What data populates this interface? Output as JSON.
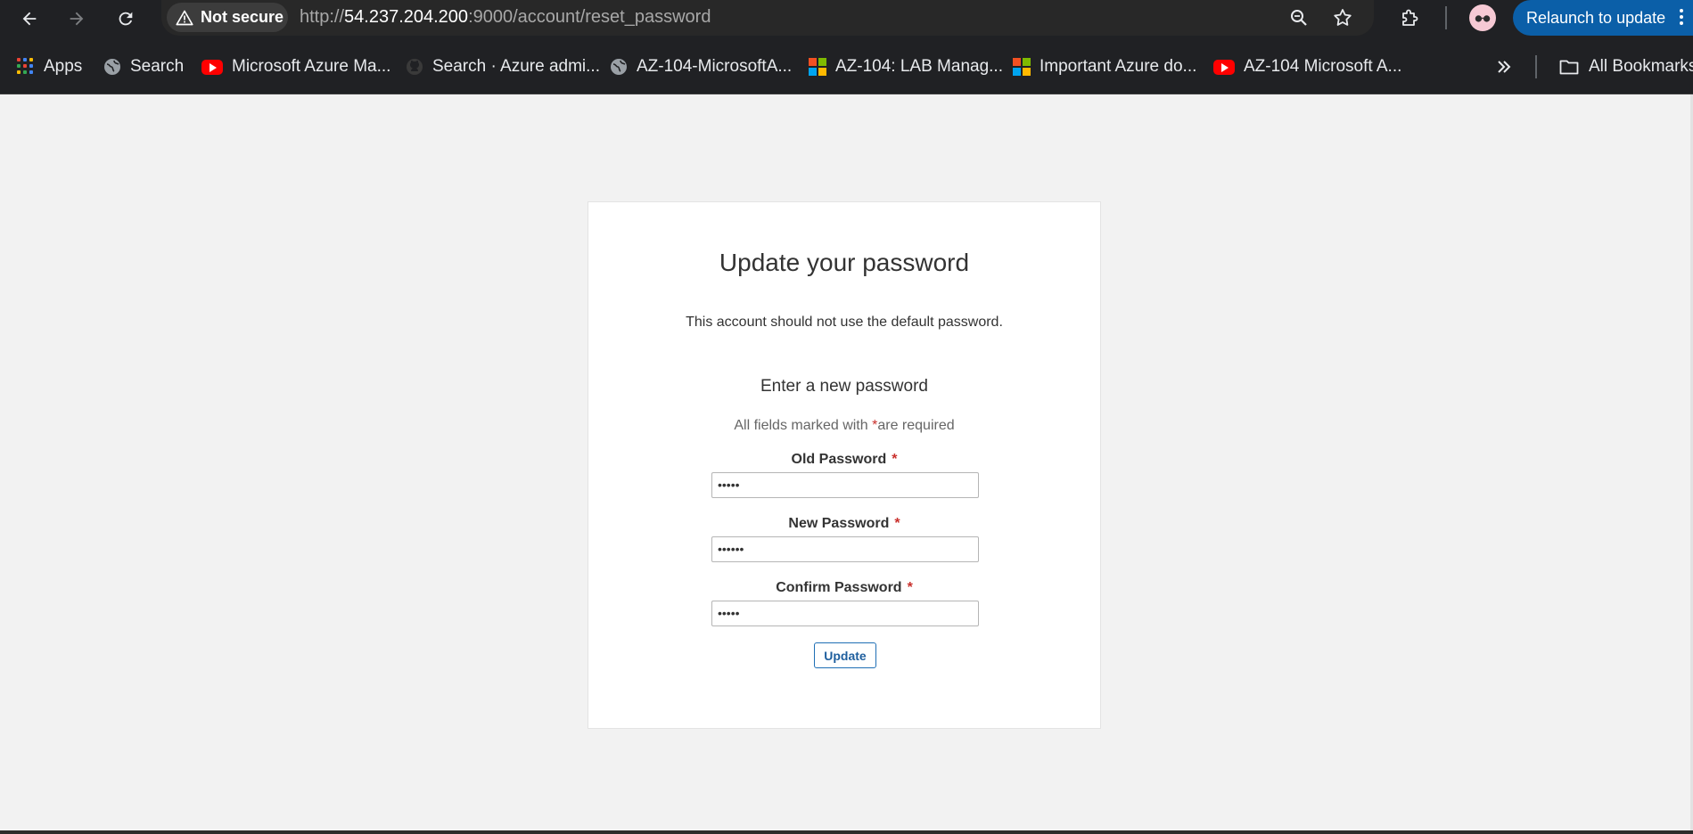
{
  "browser": {
    "security_label": "Not secure",
    "url_prefix": "http://",
    "url_host": "54.237.204.200",
    "url_rest": ":9000/account/reset_password",
    "relaunch_label": "Relaunch to update",
    "bookmarks": [
      {
        "label": "Apps",
        "icon": "apps-grid-icon"
      },
      {
        "label": "Search",
        "icon": "globe-icon"
      },
      {
        "label": "Microsoft Azure Ma...",
        "icon": "youtube-icon"
      },
      {
        "label": "Search · Azure admi...",
        "icon": "github-icon"
      },
      {
        "label": "AZ-104-MicrosoftA...",
        "icon": "globe-icon"
      },
      {
        "label": "AZ-104: LAB Manag...",
        "icon": "microsoft-icon"
      },
      {
        "label": "Important Azure do...",
        "icon": "microsoft-icon"
      },
      {
        "label": "AZ-104 Microsoft A...",
        "icon": "youtube-icon"
      }
    ],
    "all_bookmarks_label": "All Bookmarks"
  },
  "form": {
    "title": "Update your password",
    "notice": "This account should not use the default password.",
    "subtitle": "Enter a new password",
    "required_prefix": "All fields marked with",
    "required_star": "*",
    "required_suffix": "are required",
    "fields": [
      {
        "label": "Old Password",
        "value": "•••••"
      },
      {
        "label": "New Password",
        "value": "••••••"
      },
      {
        "label": "Confirm Password",
        "value": "•••••"
      }
    ],
    "submit_label": "Update"
  },
  "colors": {
    "chrome_bg": "#202124",
    "page_bg": "#f2f2f2",
    "relaunch_bg": "#0b5fa8",
    "required": "#c9302c",
    "button_border": "#1f6fb5"
  }
}
